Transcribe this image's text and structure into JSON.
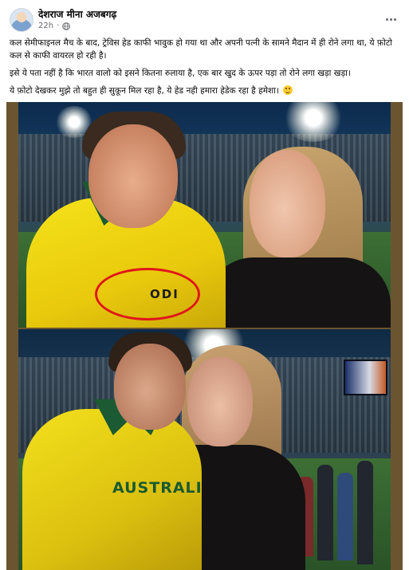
{
  "post": {
    "author": "देशराज मीना अजबगढ़",
    "time": "22h",
    "visibility_icon": "globe-icon",
    "more_icon": "more-options-icon",
    "paragraphs": [
      "कल सेमीफाइनल मैच के बाद, ट्रेविस हेड काफी भावुक हो गया था और अपनी पत्नी के सामने मैदान में ही रोने लगा था, ये फ़ोटो कल से काफी वायरल हो रही है।",
      "इसे ये पता नहीं है कि भारत वालो को इसने कितना रुलाया है, एक बार खुद के ऊपर पड़ा तो रोने लगा खड़ा खड़ा।",
      "ये फ़ोटो देखकर मुझे तो बहुत ही सुकून मिल रहा है, ये हेड नही हमारा हेडेक रहा है हमेशा।"
    ],
    "emoji": "winking-tongue-face-emoji"
  },
  "media": {
    "photo1": {
      "jersey_text": "ODI"
    },
    "photo2": {
      "jersey_text": "AUSTRALI"
    }
  },
  "colors": {
    "highlight_circle": "#e0161b",
    "frame": "#6b5530",
    "meta_text": "#65676b"
  }
}
